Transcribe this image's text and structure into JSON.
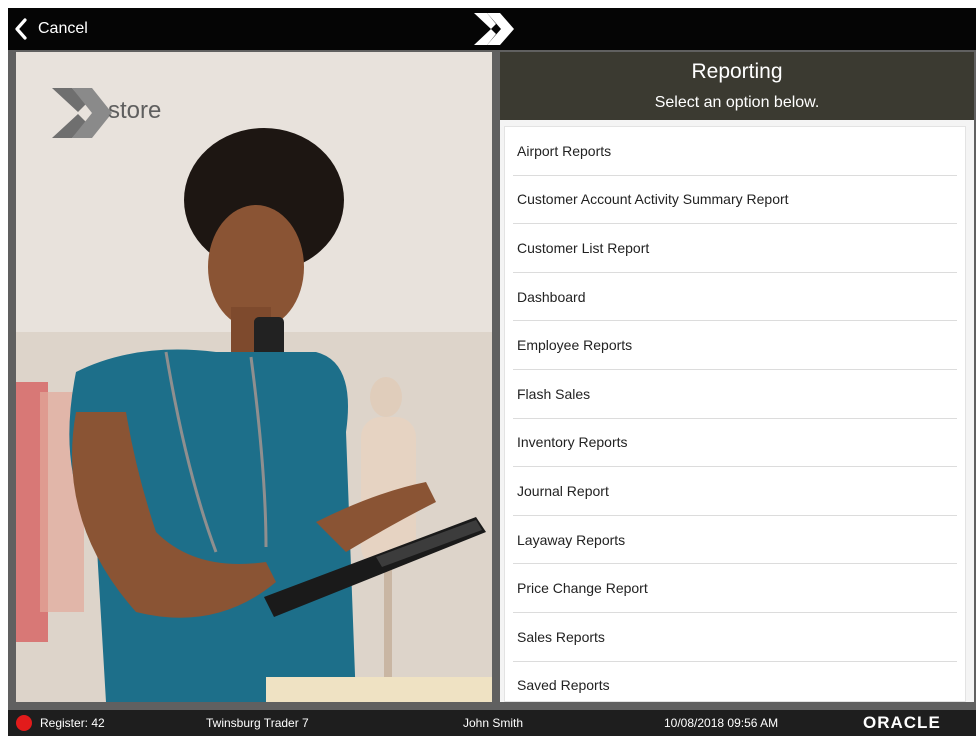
{
  "topbar": {
    "cancel_label": "Cancel",
    "cancel_icon": "chevron-left-icon",
    "logo_icon": "x-logo-icon"
  },
  "photo": {
    "logo_text": "store",
    "logo_icon": "xstore-logo"
  },
  "panel": {
    "title": "Reporting",
    "subtitle": "Select an option below.",
    "items": [
      {
        "label": "Airport Reports"
      },
      {
        "label": "Customer Account Activity Summary Report"
      },
      {
        "label": "Customer List Report"
      },
      {
        "label": "Dashboard"
      },
      {
        "label": "Employee Reports"
      },
      {
        "label": "Flash Sales"
      },
      {
        "label": "Inventory Reports"
      },
      {
        "label": "Journal Report"
      },
      {
        "label": "Layaway Reports"
      },
      {
        "label": "Price Change Report"
      },
      {
        "label": "Sales Reports"
      },
      {
        "label": "Saved Reports"
      }
    ]
  },
  "status": {
    "register": "Register: 42",
    "store": "Twinsburg Trader 7",
    "user": "John Smith",
    "datetime": "10/08/2018 09:56 AM",
    "brand": "ORACLE",
    "status_color": "#e21b1b"
  },
  "colors": {
    "header_bg": "#3b3a31",
    "topbar_bg": "#050505",
    "status_bg": "#1e1e1e"
  }
}
